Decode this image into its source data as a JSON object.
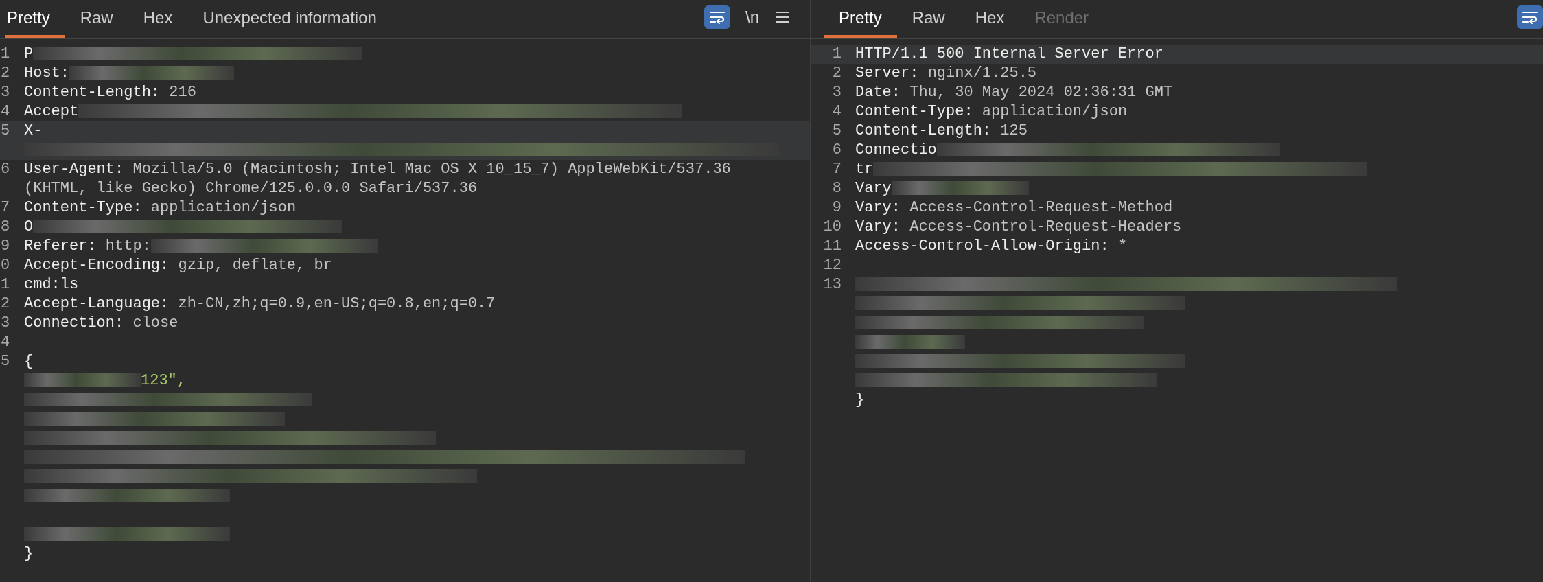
{
  "panels": [
    {
      "tabs": [
        {
          "label": "Pretty",
          "selected": true,
          "disabled": false
        },
        {
          "label": "Raw",
          "selected": false,
          "disabled": false
        },
        {
          "label": "Hex",
          "selected": false,
          "disabled": false
        },
        {
          "label": "Unexpected information",
          "selected": false,
          "disabled": false
        }
      ],
      "toolbar": [
        {
          "kind": "wrap",
          "on": true
        },
        {
          "kind": "newline",
          "label": "\\n"
        },
        {
          "kind": "menu"
        }
      ],
      "lines": [
        {
          "number": "1",
          "highlighted": false,
          "segments": [
            {
              "kind": "key",
              "text": "P"
            },
            {
              "kind": "redacted"
            }
          ]
        },
        {
          "number": "2",
          "highlighted": false,
          "segments": [
            {
              "kind": "key",
              "text": "Host:"
            },
            {
              "kind": "redacted"
            }
          ]
        },
        {
          "number": "3",
          "highlighted": false,
          "segments": [
            {
              "kind": "key",
              "text": "Content-Length:"
            },
            {
              "kind": "value",
              "text": "216"
            }
          ]
        },
        {
          "number": "4",
          "highlighted": false,
          "segments": [
            {
              "kind": "key",
              "text": "Accept"
            },
            {
              "kind": "redacted"
            }
          ]
        },
        {
          "number": "5",
          "highlighted": true,
          "segments": [
            {
              "kind": "key",
              "text": "X-"
            },
            {
              "kind": "redacted"
            }
          ]
        },
        {
          "number": "6",
          "highlighted": false,
          "segments": [
            {
              "kind": "key",
              "text": "User-Agent:"
            },
            {
              "kind": "value",
              "text": "Mozilla/5.0 (Macintosh; Intel Mac OS X 10_15_7) AppleWebKit/537.36 (KHTML, like Gecko) Chrome/125.0.0.0 Safari/537.36"
            }
          ]
        },
        {
          "number": "7",
          "highlighted": false,
          "segments": [
            {
              "kind": "key",
              "text": "Content-Type:"
            },
            {
              "kind": "value",
              "text": "application/json"
            }
          ]
        },
        {
          "number": "8",
          "highlighted": false,
          "segments": [
            {
              "kind": "key",
              "text": "O"
            },
            {
              "kind": "redacted"
            }
          ]
        },
        {
          "number": "9",
          "highlighted": false,
          "segments": [
            {
              "kind": "key",
              "text": "Referer:"
            },
            {
              "kind": "value",
              "text": "http:"
            },
            {
              "kind": "redacted"
            }
          ]
        },
        {
          "number": "0",
          "highlighted": false,
          "segments": [
            {
              "kind": "key",
              "text": "Accept-Encoding:"
            },
            {
              "kind": "value",
              "text": "gzip, deflate, br"
            }
          ]
        },
        {
          "number": "1",
          "highlighted": false,
          "segments": [
            {
              "kind": "key",
              "text": "cmd:"
            },
            {
              "kind": "plain",
              "text": "ls"
            }
          ]
        },
        {
          "number": "2",
          "highlighted": false,
          "segments": [
            {
              "kind": "key",
              "text": "Accept-Language:"
            },
            {
              "kind": "value",
              "text": "zh-CN,zh;q=0.9,en-US;q=0.8,en;q=0.7"
            }
          ]
        },
        {
          "number": "3",
          "highlighted": false,
          "segments": [
            {
              "kind": "key",
              "text": "Connection:"
            },
            {
              "kind": "value",
              "text": "close"
            }
          ]
        },
        {
          "number": "4",
          "highlighted": false
        },
        {
          "number": "5",
          "highlighted": false,
          "segments": [
            {
              "kind": "plain",
              "text": "{"
            }
          ]
        },
        {
          "highlighted": false,
          "segments": [
            {
              "kind": "redacted"
            },
            {
              "kind": "string",
              "text": "123\","
            }
          ]
        },
        {
          "highlighted": false,
          "segments": [
            {
              "kind": "redacted"
            }
          ]
        },
        {
          "highlighted": false,
          "segments": [
            {
              "kind": "redacted"
            }
          ]
        },
        {
          "highlighted": false,
          "segments": [
            {
              "kind": "redacted"
            }
          ]
        },
        {
          "highlighted": false,
          "segments": [
            {
              "kind": "redacted"
            }
          ]
        },
        {
          "highlighted": false,
          "segments": [
            {
              "kind": "redacted"
            }
          ]
        },
        {
          "highlighted": false,
          "segments": [
            {
              "kind": "redacted"
            }
          ]
        },
        {
          "highlighted": false
        },
        {
          "highlighted": false,
          "segments": [
            {
              "kind": "redacted"
            }
          ]
        },
        {
          "highlighted": false,
          "segments": [
            {
              "kind": "plain",
              "text": "}"
            }
          ]
        }
      ]
    },
    {
      "tabs": [
        {
          "label": "Pretty",
          "selected": true,
          "disabled": false
        },
        {
          "label": "Raw",
          "selected": false,
          "disabled": false
        },
        {
          "label": "Hex",
          "selected": false,
          "disabled": false
        },
        {
          "label": "Render",
          "selected": false,
          "disabled": true
        }
      ],
      "toolbar": [
        {
          "kind": "wrap",
          "on": true
        }
      ],
      "lines": [
        {
          "number": "1",
          "highlighted": true,
          "segments": [
            {
              "kind": "key",
              "text": "HTTP/1.1 500 Internal Server Error"
            }
          ]
        },
        {
          "number": "2",
          "highlighted": false,
          "segments": [
            {
              "kind": "key",
              "text": "Server:"
            },
            {
              "kind": "value",
              "text": "nginx/1.25.5"
            }
          ]
        },
        {
          "number": "3",
          "highlighted": false,
          "segments": [
            {
              "kind": "key",
              "text": "Date:"
            },
            {
              "kind": "value",
              "text": "Thu, 30 May 2024 02:36:31 GMT"
            }
          ]
        },
        {
          "number": "4",
          "highlighted": false,
          "segments": [
            {
              "kind": "key",
              "text": "Content-Type:"
            },
            {
              "kind": "value",
              "text": "application/json"
            }
          ]
        },
        {
          "number": "5",
          "highlighted": false,
          "segments": [
            {
              "kind": "key",
              "text": "Content-Length:"
            },
            {
              "kind": "value",
              "text": "125"
            }
          ]
        },
        {
          "number": "6",
          "highlighted": false,
          "segments": [
            {
              "kind": "key",
              "text": "Connectio"
            },
            {
              "kind": "redacted"
            }
          ]
        },
        {
          "number": "7",
          "highlighted": false,
          "segments": [
            {
              "kind": "key",
              "text": "tr"
            },
            {
              "kind": "redacted"
            }
          ]
        },
        {
          "number": "8",
          "highlighted": false,
          "segments": [
            {
              "kind": "key",
              "text": "Vary"
            },
            {
              "kind": "redacted"
            }
          ]
        },
        {
          "number": "9",
          "highlighted": false,
          "segments": [
            {
              "kind": "key",
              "text": "Vary:"
            },
            {
              "kind": "value",
              "text": "Access-Control-Request-Method"
            }
          ]
        },
        {
          "number": "10",
          "highlighted": false,
          "segments": [
            {
              "kind": "key",
              "text": "Vary:"
            },
            {
              "kind": "value",
              "text": "Access-Control-Request-Headers"
            }
          ]
        },
        {
          "number": "11",
          "highlighted": false,
          "segments": [
            {
              "kind": "key",
              "text": "Access-Control-Allow-Origin:"
            },
            {
              "kind": "value",
              "text": "*"
            }
          ]
        },
        {
          "number": "12",
          "highlighted": false
        },
        {
          "number": "13",
          "highlighted": false,
          "segments": [
            {
              "kind": "redacted"
            }
          ]
        },
        {
          "highlighted": false,
          "segments": [
            {
              "kind": "redacted"
            }
          ]
        },
        {
          "highlighted": false,
          "segments": [
            {
              "kind": "redacted"
            }
          ]
        },
        {
          "highlighted": false,
          "segments": [
            {
              "kind": "redacted"
            }
          ]
        },
        {
          "highlighted": false,
          "segments": [
            {
              "kind": "redacted"
            }
          ]
        },
        {
          "highlighted": false,
          "segments": [
            {
              "kind": "redacted"
            }
          ]
        },
        {
          "highlighted": false,
          "segments": [
            {
              "kind": "plain",
              "text": "}"
            }
          ]
        }
      ]
    }
  ]
}
